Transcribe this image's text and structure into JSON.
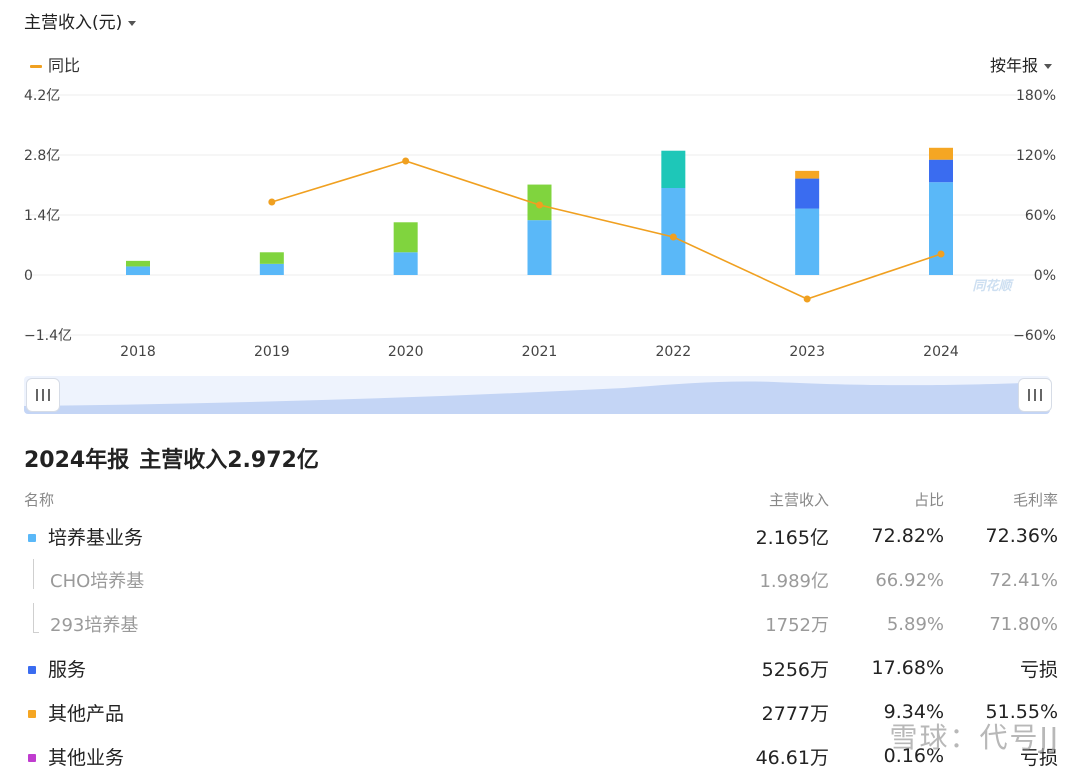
{
  "header": {
    "metric_label": "主营收入(元)",
    "legend_label": "同比",
    "period_label": "按年报"
  },
  "chart_data": {
    "type": "bar",
    "stacked": true,
    "categories": [
      "2018",
      "2019",
      "2020",
      "2021",
      "2022",
      "2023",
      "2024"
    ],
    "series": [
      {
        "values": [
          0.2,
          0.26,
          0.53,
          1.28,
          2.03,
          1.55,
          2.165
        ],
        "color": "#5ab8f8"
      },
      {
        "values": [
          0.13,
          0.27,
          0.7,
          0.83,
          0,
          0,
          0
        ],
        "color": "#80d43e"
      },
      {
        "values": [
          0,
          0,
          0,
          0,
          0.87,
          0,
          0
        ],
        "color": "#1ec7b8"
      },
      {
        "values": [
          0,
          0,
          0,
          0,
          0,
          0.7,
          0.5256
        ],
        "color": "#3a6cf0"
      },
      {
        "values": [
          0,
          0,
          0,
          0,
          0,
          0.18,
          0.2777
        ],
        "color": "#f5a623"
      }
    ],
    "line_series": {
      "name": "同比",
      "color": "#f0a020",
      "values": [
        null,
        73,
        114,
        70,
        38,
        -24,
        21
      ]
    },
    "y_left_ticks": [
      "4.2亿",
      "2.8亿",
      "1.4亿",
      "0",
      "−1.4亿"
    ],
    "y_right_ticks": [
      "180%",
      "120%",
      "60%",
      "0%",
      "−60%"
    ],
    "y_left_range": [
      -1.4,
      4.2
    ],
    "y_right_range": [
      -60,
      180
    ],
    "y_left_unit": "亿",
    "grid": true,
    "logo_text": "同花顺"
  },
  "summary": {
    "period": "2024年报",
    "title": "主营收入2.972亿"
  },
  "table": {
    "headers": {
      "name": "名称",
      "revenue": "主营收入",
      "share": "占比",
      "margin": "毛利率"
    },
    "rows": [
      {
        "name": "培养基业务",
        "revenue": "2.165亿",
        "share": "72.82%",
        "margin": "72.36%",
        "color": "#5ab8f8",
        "level": 0
      },
      {
        "name": "CHO培养基",
        "revenue": "1.989亿",
        "share": "66.92%",
        "margin": "72.41%",
        "level": 1
      },
      {
        "name": "293培养基",
        "revenue": "1752万",
        "share": "5.89%",
        "margin": "71.80%",
        "level": 1,
        "last": true
      },
      {
        "name": "服务",
        "revenue": "5256万",
        "share": "17.68%",
        "margin": "亏损",
        "color": "#3a6cf0",
        "level": 0
      },
      {
        "name": "其他产品",
        "revenue": "2777万",
        "share": "9.34%",
        "margin": "51.55%",
        "color": "#f5a623",
        "level": 0
      },
      {
        "name": "其他业务",
        "revenue": "46.61万",
        "share": "0.16%",
        "margin": "亏损",
        "color": "#c03ccf",
        "level": 0
      }
    ]
  },
  "watermark": "雪球：代号JJ"
}
